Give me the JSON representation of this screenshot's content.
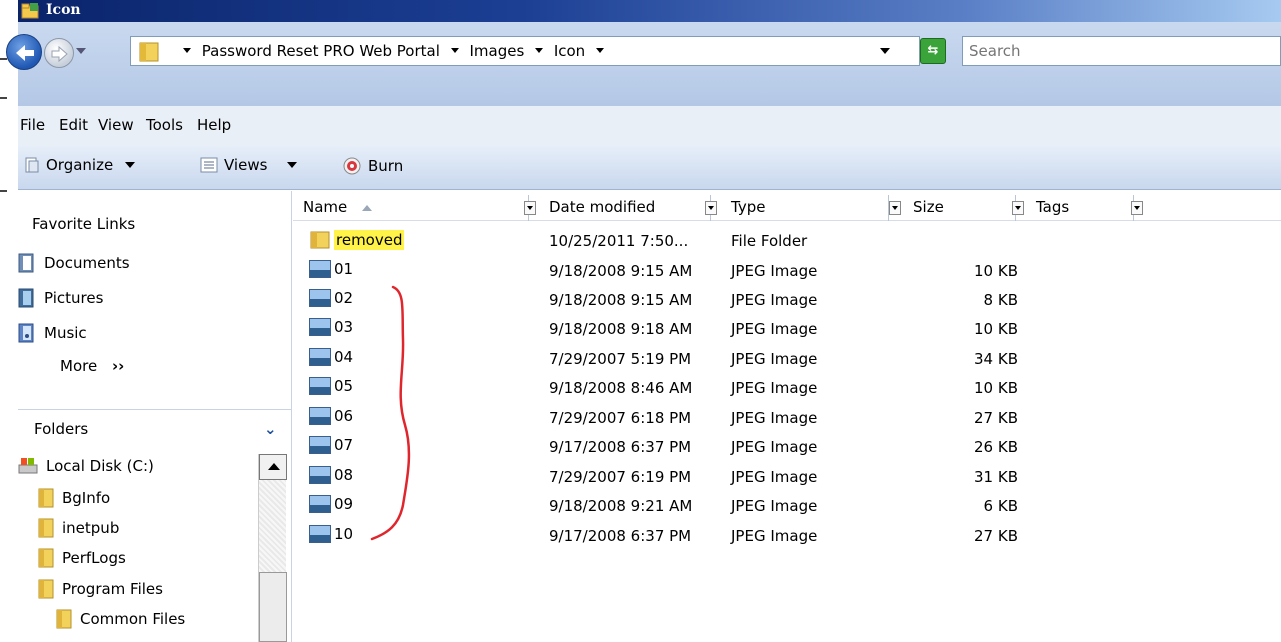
{
  "window": {
    "title": "Icon"
  },
  "address": {
    "crumbs": [
      "Password Reset PRO Web Portal",
      "Images",
      "Icon"
    ],
    "search_placeholder": "Search"
  },
  "menu": [
    "File",
    "Edit",
    "View",
    "Tools",
    "Help"
  ],
  "toolbar": {
    "organize": "Organize",
    "views": "Views",
    "burn": "Burn"
  },
  "nav": {
    "favorites_title": "Favorite Links",
    "favorites": [
      "Documents",
      "Pictures",
      "Music"
    ],
    "more": "More",
    "folders_title": "Folders",
    "tree": [
      "Local Disk (C:)",
      "BgInfo",
      "inetpub",
      "PerfLogs",
      "Program Files",
      "Common Files"
    ]
  },
  "columns": [
    "Name",
    "Date modified",
    "Type",
    "Size",
    "Tags"
  ],
  "files": [
    {
      "name": "removed",
      "date": "10/25/2011 7:50...",
      "type": "File Folder",
      "size": ""
    },
    {
      "name": "01",
      "date": "9/18/2008 9:15 AM",
      "type": "JPEG Image",
      "size": "10 KB"
    },
    {
      "name": "02",
      "date": "9/18/2008 9:15 AM",
      "type": "JPEG Image",
      "size": "8 KB"
    },
    {
      "name": "03",
      "date": "9/18/2008 9:18 AM",
      "type": "JPEG Image",
      "size": "10 KB"
    },
    {
      "name": "04",
      "date": "7/29/2007 5:19 PM",
      "type": "JPEG Image",
      "size": "34 KB"
    },
    {
      "name": "05",
      "date": "9/18/2008 8:46 AM",
      "type": "JPEG Image",
      "size": "10 KB"
    },
    {
      "name": "06",
      "date": "7/29/2007 6:18 PM",
      "type": "JPEG Image",
      "size": "27 KB"
    },
    {
      "name": "07",
      "date": "9/17/2008 6:37 PM",
      "type": "JPEG Image",
      "size": "26 KB"
    },
    {
      "name": "08",
      "date": "7/29/2007 6:19 PM",
      "type": "JPEG Image",
      "size": "31 KB"
    },
    {
      "name": "09",
      "date": "9/18/2008 9:21 AM",
      "type": "JPEG Image",
      "size": "6 KB"
    },
    {
      "name": "10",
      "date": "9/17/2008 6:37 PM",
      "type": "JPEG Image",
      "size": "27 KB"
    }
  ],
  "colors": {
    "highlight": "#fff34a",
    "annotation": "#e0262d",
    "titlebar": "#0a246a"
  }
}
